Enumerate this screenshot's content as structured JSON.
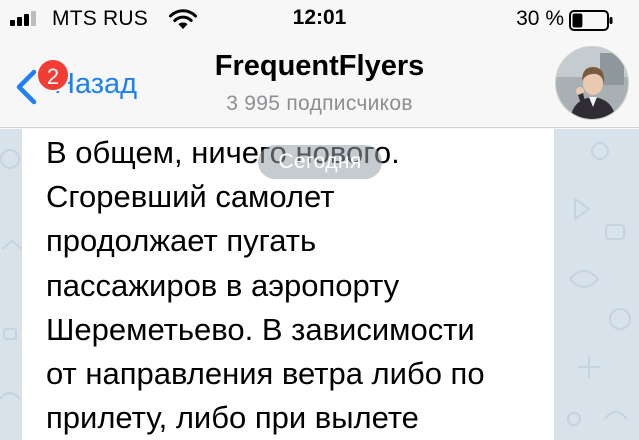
{
  "status_bar": {
    "carrier": "MTS RUS",
    "time": "12:01",
    "battery_percent": "30 %",
    "battery_level": 0.3,
    "signal_bars": 3
  },
  "nav": {
    "back_label": "Назад",
    "back_badge": "2",
    "title": "FrequentFlyers",
    "subtitle": "3 995 подписчиков",
    "accent_color": "#1f7ff5",
    "badge_color": "#f23c34"
  },
  "chat": {
    "date_pill": "Сегодня",
    "message_text": "В общем, ничего нового.\nСгоревший самолет\nпродолжает пугать\nпассажиров в аэропорту\nШереметьево. В зависимости\nот направления ветра либо по\nприлету, либо при вылете",
    "background_color": "#d8e2eb"
  },
  "icons": {
    "signal": "signal-icon",
    "wifi": "wifi-icon",
    "battery": "battery-icon",
    "back": "chevron-left-icon"
  }
}
